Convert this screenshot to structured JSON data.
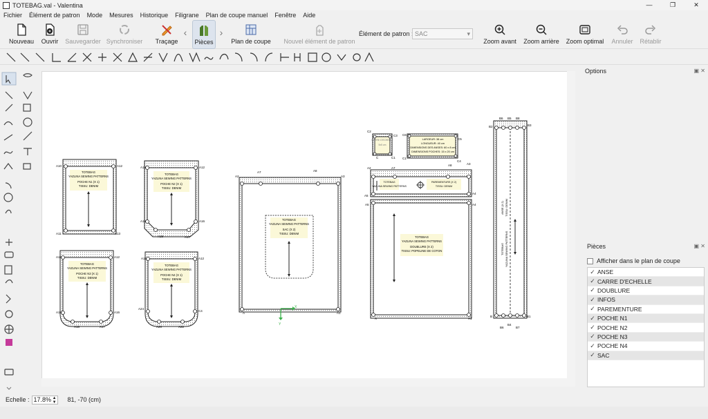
{
  "window": {
    "title": "TOTEBAG.val - Valentina",
    "minimize": "—",
    "maximize": "❐",
    "close": "✕"
  },
  "menu": [
    "Fichier",
    "Élément de patron",
    "Mode",
    "Mesures",
    "Historique",
    "Filigrane",
    "Plan de coupe manuel",
    "Fenêtre",
    "Aide"
  ],
  "toolbar": {
    "new": "Nouveau",
    "open": "Ouvrir",
    "save": "Sauvegarder",
    "sync": "Synchroniser",
    "tracing": "Traçage",
    "pieces": "Pièces",
    "layout": "Plan de coupe",
    "new_piece": "Nouvel élément de patron",
    "piece_label": "Élément de patron :",
    "piece_value": "SAC",
    "zoom_in": "Zoom avant",
    "zoom_out": "Zoom arrière",
    "zoom_fit": "Zoom optimal",
    "undo": "Annuler",
    "redo": "Rétablir"
  },
  "options_panel": {
    "title": "Options"
  },
  "pieces_panel": {
    "title": "Pièces",
    "show_in_layout": "Afficher dans le plan de coupe",
    "items": [
      {
        "name": "ANSE",
        "checked": true,
        "selected": false
      },
      {
        "name": "CARRE D'ECHELLE",
        "checked": true,
        "selected": true
      },
      {
        "name": "DOUBLURE",
        "checked": true,
        "selected": false
      },
      {
        "name": "INFOS",
        "checked": true,
        "selected": true
      },
      {
        "name": "PAREMENTURE",
        "checked": true,
        "selected": false
      },
      {
        "name": "POCHE N1",
        "checked": true,
        "selected": true
      },
      {
        "name": "POCHE N2",
        "checked": true,
        "selected": false
      },
      {
        "name": "POCHE N3",
        "checked": true,
        "selected": true
      },
      {
        "name": "POCHE N4",
        "checked": true,
        "selected": false
      },
      {
        "name": "SAC",
        "checked": true,
        "selected": true
      }
    ]
  },
  "status": {
    "scale_label": "Echelle :",
    "scale_value": "17.8%",
    "coords": "81, -70 (cm)"
  },
  "pattern": {
    "brand": "TOTEBAG",
    "maker": "YAZLINA SEWING PATTERNS",
    "fabric_denim": "TISSU: DENIM",
    "poche1": "POCHE N1 (X 1)",
    "poche2": "POCHE N2 (X 1)",
    "poche3": "POCHE N3 (X 1)",
    "poche4": "POCHE N4 (X 1)",
    "sac": "SAC (X 2)",
    "doublure": "DOUBLURE (X 2)",
    "fabric_poplin": "TISSU: POPELINE DE COTON",
    "parementure": "PAREMENTURE (X 2)",
    "carre": "CARRE D'ECHELLE",
    "carre_size": "5x5 cm",
    "info1": "LARGEUR: 38 cm",
    "info2": "LONGUEUR: 40 cm",
    "info3": "DIMENSIONS DES ANSES: 60 x 8 cm",
    "info4": "DIMENSIONS POCHES: 15 x 20 cm",
    "anse": "ANSE (X 2)",
    "axis_x": "X",
    "axis_y": "Y"
  }
}
